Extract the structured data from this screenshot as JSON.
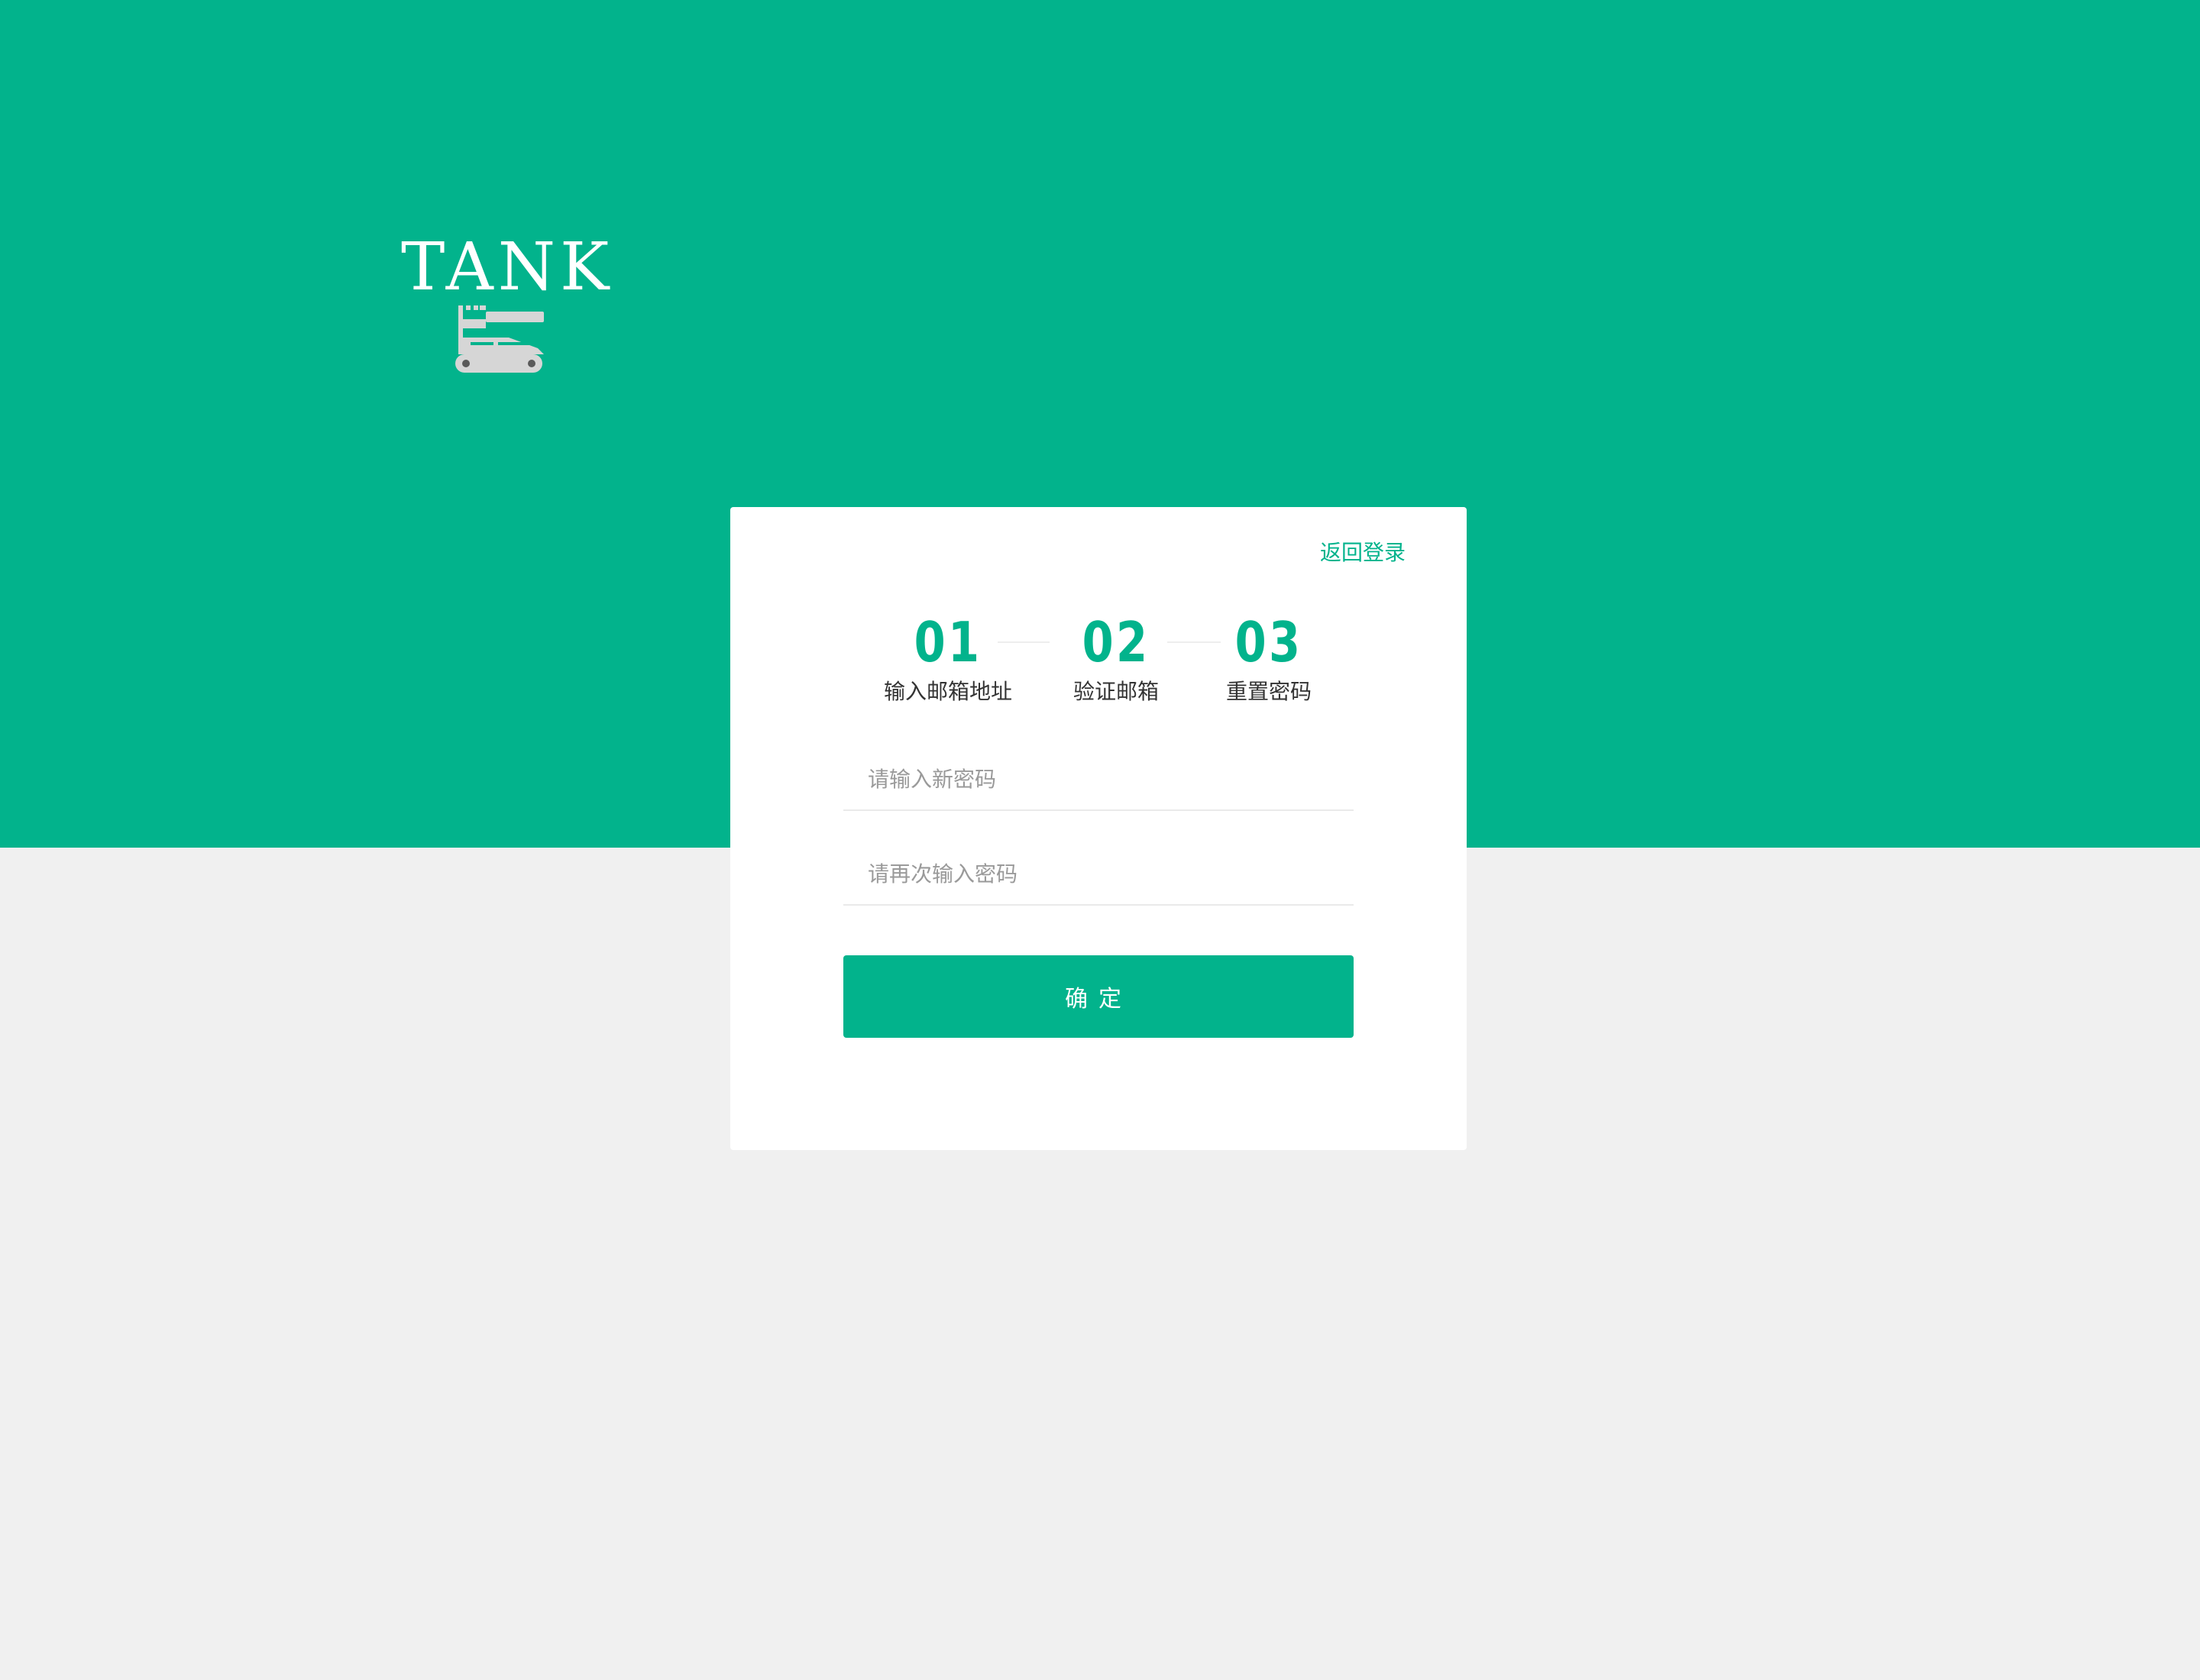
{
  "brand": {
    "name": "TANK",
    "logo_icon": "tank-icon"
  },
  "colors": {
    "primary": "#02b38c",
    "background": "#f0f0f0",
    "card": "#ffffff",
    "text": "#333333",
    "placeholder": "#9a9a9a"
  },
  "card": {
    "back_link": "返回登录",
    "steps": [
      {
        "number": "01",
        "label": "输入邮箱地址"
      },
      {
        "number": "02",
        "label": "验证邮箱"
      },
      {
        "number": "03",
        "label": "重置密码"
      }
    ],
    "new_password": {
      "value": "",
      "placeholder": "请输入新密码"
    },
    "confirm_password": {
      "value": "",
      "placeholder": "请再次输入密码"
    },
    "submit_label": "确定"
  }
}
